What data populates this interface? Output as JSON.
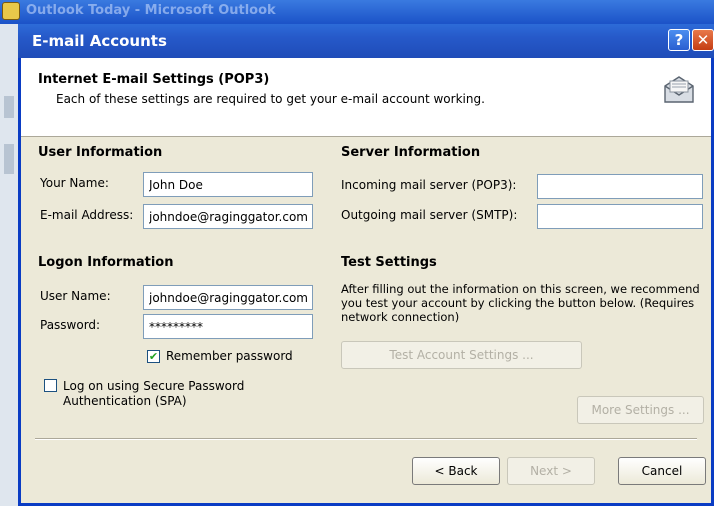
{
  "background_window": {
    "title": "Outlook Today - Microsoft Outlook"
  },
  "dialog": {
    "title": "E-mail Accounts",
    "help_glyph": "?",
    "close_glyph": "✕"
  },
  "header": {
    "title": "Internet E-mail Settings (POP3)",
    "subtitle": "Each of these settings are required to get your e-mail account working.",
    "icon": "mail-settings-icon"
  },
  "user_info": {
    "heading": "User Information",
    "name_label": "Your Name:",
    "name_value": "John Doe",
    "email_label": "E-mail Address:",
    "email_value": "johndoe@raginggator.com"
  },
  "server_info": {
    "heading": "Server Information",
    "incoming_label": "Incoming mail server (POP3):",
    "incoming_value": "",
    "outgoing_label": "Outgoing mail server (SMTP):",
    "outgoing_value": ""
  },
  "logon_info": {
    "heading": "Logon Information",
    "username_label": "User Name:",
    "username_value": "johndoe@raginggator.com",
    "password_label": "Password:",
    "password_value": "*********",
    "remember_label": "Remember password",
    "remember_checked": true,
    "spa_label": "Log on using Secure Password Authentication (SPA)",
    "spa_checked": false
  },
  "test_settings": {
    "heading": "Test Settings",
    "description": "After filling out the information on this screen, we recommend you test your account by clicking the button below. (Requires network connection)",
    "test_button": "Test Account Settings ..."
  },
  "buttons": {
    "more_settings": "More Settings ...",
    "back": "< Back",
    "next": "Next >",
    "cancel": "Cancel"
  },
  "colors": {
    "titlebar": "#2659c9",
    "dialog_bg": "#ece9d8",
    "checkmark": "#21a121"
  }
}
